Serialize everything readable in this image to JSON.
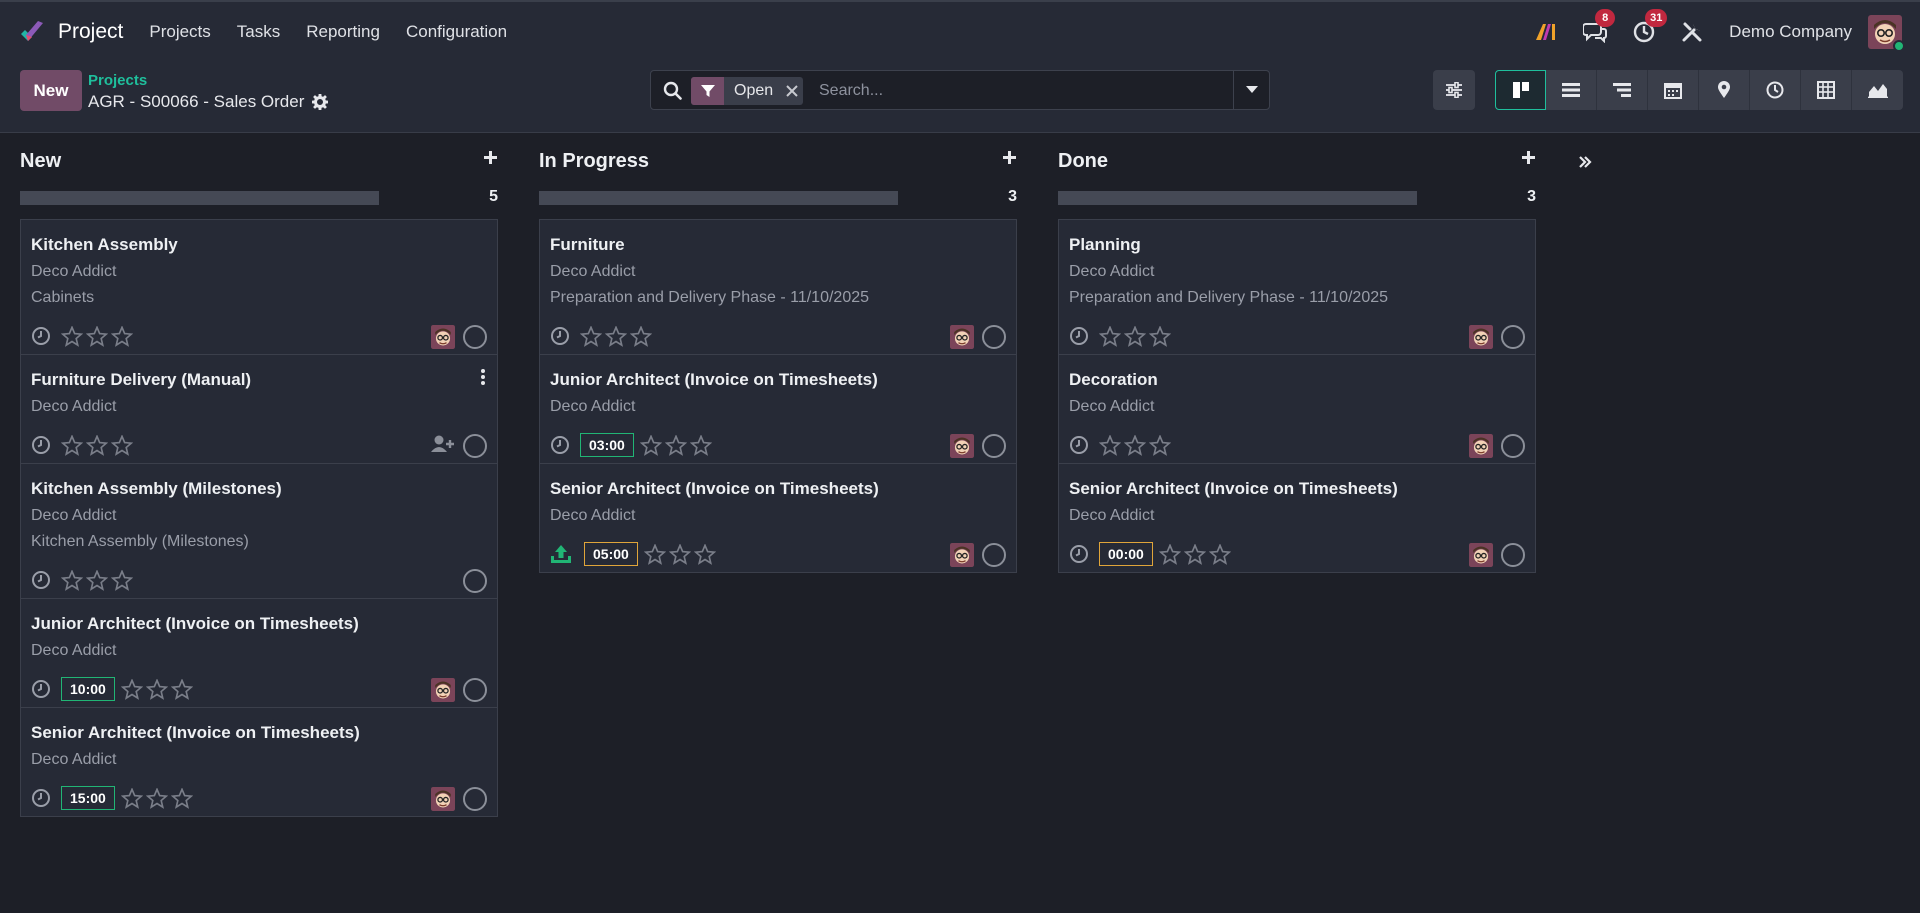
{
  "navbar": {
    "app_name": "Project",
    "menu": [
      "Projects",
      "Tasks",
      "Reporting",
      "Configuration"
    ],
    "messages_badge": "8",
    "activities_badge": "31",
    "company": "Demo Company"
  },
  "control": {
    "new_label": "New",
    "breadcrumb": "Projects",
    "record_title": "AGR - S00066 - Sales Order",
    "search_facet": "Open",
    "search_placeholder": "Search..."
  },
  "colors": {
    "accent": "#714b67",
    "link": "#1fbf9c",
    "badge": "#c1283f",
    "hours_ok": "#21b575",
    "hours_warn": "#e0a53a"
  },
  "columns": [
    {
      "title": "New",
      "count": "5",
      "cards": [
        {
          "title": "Kitchen Assembly",
          "customer": "Deco Addict",
          "extra": "Cabinets"
        },
        {
          "title": "Furniture Delivery (Manual)",
          "customer": "Deco Addict"
        },
        {
          "title": "Kitchen Assembly (Milestones)",
          "customer": "Deco Addict",
          "extra": "Kitchen Assembly (Milestones)"
        },
        {
          "title": "Junior Architect (Invoice on Timesheets)",
          "customer": "Deco Addict",
          "hours": "10:00"
        },
        {
          "title": "Senior Architect (Invoice on Timesheets)",
          "customer": "Deco Addict",
          "hours": "15:00"
        }
      ]
    },
    {
      "title": "In Progress",
      "count": "3",
      "cards": [
        {
          "title": "Furniture",
          "customer": "Deco Addict",
          "extra": "Preparation and Delivery Phase - 11/10/2025"
        },
        {
          "title": "Junior Architect (Invoice on Timesheets)",
          "customer": "Deco Addict",
          "hours": "03:00"
        },
        {
          "title": "Senior Architect (Invoice on Timesheets)",
          "customer": "Deco Addict",
          "hours": "05:00"
        }
      ]
    },
    {
      "title": "Done",
      "count": "3",
      "cards": [
        {
          "title": "Planning",
          "customer": "Deco Addict",
          "extra": "Preparation and Delivery Phase - 11/10/2025"
        },
        {
          "title": "Decoration",
          "customer": "Deco Addict"
        },
        {
          "title": "Senior Architect (Invoice on Timesheets)",
          "customer": "Deco Addict",
          "hours": "00:00"
        }
      ]
    }
  ]
}
